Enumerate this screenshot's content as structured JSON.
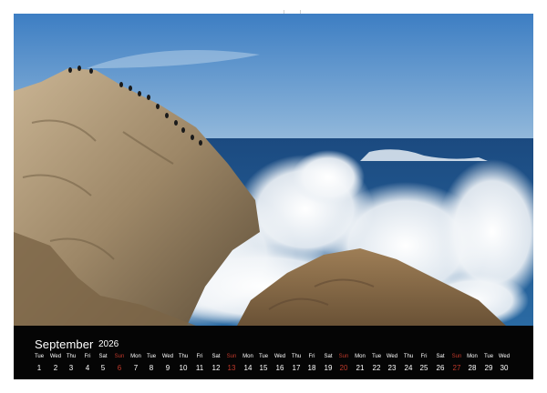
{
  "calendar": {
    "month": "September",
    "year": "2026",
    "sunday_color": "#c0392b",
    "days": [
      {
        "name": "Tue",
        "num": "1"
      },
      {
        "name": "Wed",
        "num": "2"
      },
      {
        "name": "Thu",
        "num": "3"
      },
      {
        "name": "Fri",
        "num": "4"
      },
      {
        "name": "Sat",
        "num": "5"
      },
      {
        "name": "Sun",
        "num": "6"
      },
      {
        "name": "Mon",
        "num": "7"
      },
      {
        "name": "Tue",
        "num": "8"
      },
      {
        "name": "Wed",
        "num": "9"
      },
      {
        "name": "Thu",
        "num": "10"
      },
      {
        "name": "Fri",
        "num": "11"
      },
      {
        "name": "Sat",
        "num": "12"
      },
      {
        "name": "Sun",
        "num": "13"
      },
      {
        "name": "Mon",
        "num": "14"
      },
      {
        "name": "Tue",
        "num": "15"
      },
      {
        "name": "Wed",
        "num": "16"
      },
      {
        "name": "Thu",
        "num": "17"
      },
      {
        "name": "Fri",
        "num": "18"
      },
      {
        "name": "Sat",
        "num": "19"
      },
      {
        "name": "Sun",
        "num": "20"
      },
      {
        "name": "Mon",
        "num": "21"
      },
      {
        "name": "Tue",
        "num": "22"
      },
      {
        "name": "Wed",
        "num": "23"
      },
      {
        "name": "Thu",
        "num": "24"
      },
      {
        "name": "Fri",
        "num": "25"
      },
      {
        "name": "Sat",
        "num": "26"
      },
      {
        "name": "Sun",
        "num": "27"
      },
      {
        "name": "Mon",
        "num": "28"
      },
      {
        "name": "Tue",
        "num": "29"
      },
      {
        "name": "Wed",
        "num": "30"
      }
    ]
  },
  "photo": {
    "subject": "waves crashing on coastal rocks with seabirds",
    "colors": {
      "sky_top": "#3f80c4",
      "sky_bottom": "#8fb6d9",
      "sea": "#1f4f86",
      "rock": "#a08c6c",
      "foam": "#f4f6f8"
    }
  }
}
